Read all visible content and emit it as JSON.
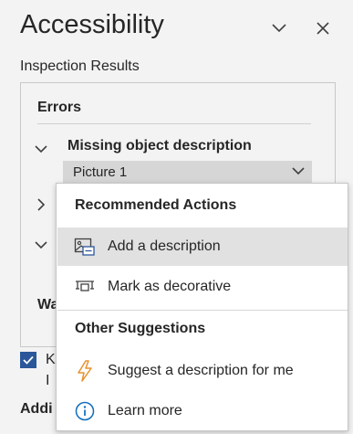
{
  "pane": {
    "title": "Accessibility",
    "section_label": "Inspection Results"
  },
  "results": {
    "errors_heading": "Errors",
    "issue_title": "Missing object description",
    "item_selected": "Picture 1",
    "warnings_partial": "Wa"
  },
  "bottom": {
    "keep_line1": "K",
    "keep_line2": "I",
    "additional_partial": "Addi"
  },
  "menu": {
    "recommended_heading": "Recommended Actions",
    "items_recommended": [
      {
        "label": "Add a description",
        "icon": "add-description-icon"
      },
      {
        "label": "Mark as decorative",
        "icon": "mark-decorative-icon"
      }
    ],
    "other_heading": "Other Suggestions",
    "items_other": [
      {
        "label": "Suggest a description for me",
        "icon": "lightning-icon"
      },
      {
        "label": "Learn more",
        "icon": "info-icon"
      }
    ]
  },
  "colors": {
    "accent": "#2b579a",
    "info_blue": "#0f6cbd",
    "lightning_orange": "#e8912d"
  }
}
